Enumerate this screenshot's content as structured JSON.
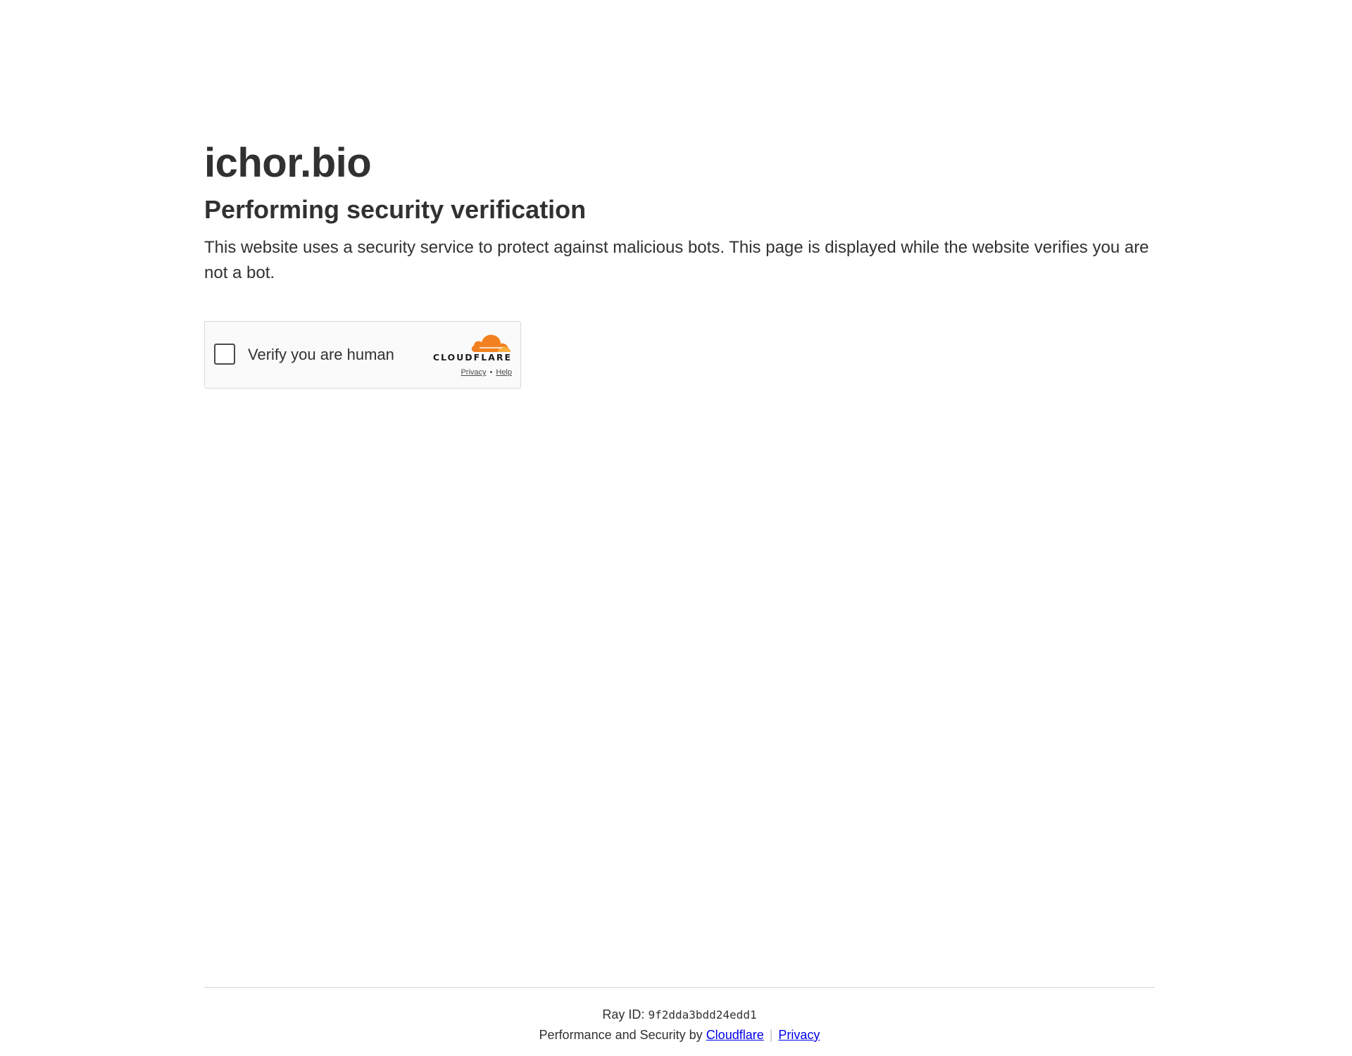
{
  "main": {
    "site_name": "ichor.bio",
    "heading": "Performing security verification",
    "description": "This website uses a security service to protect against malicious bots. This page is displayed while the website verifies you are not a bot."
  },
  "widget": {
    "checkbox_label": "Verify you are human",
    "brand_name": "CLOUDFLARE",
    "privacy_link": "Privacy",
    "dot": "•",
    "help_link": "Help",
    "brand_icon": "cloudflare-cloud-icon",
    "brand_color": "#f38020"
  },
  "footer": {
    "ray_label": "Ray ID:",
    "ray_value": "9f2dda3bdd24edd1",
    "performance_text": "Performance and Security by",
    "cloudflare_link": "Cloudflare",
    "separator": "|",
    "privacy_link": "Privacy",
    "link_color": "#0000ee"
  }
}
